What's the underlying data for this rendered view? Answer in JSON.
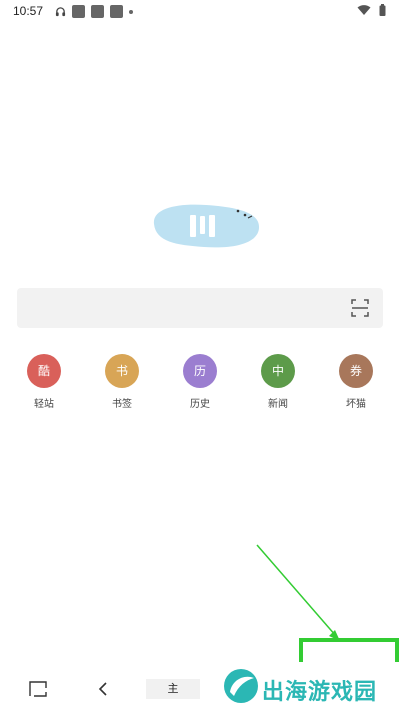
{
  "status_bar": {
    "time": "10:57"
  },
  "search": {
    "placeholder": ""
  },
  "shortcuts": [
    {
      "glyph": "酷",
      "label": "轻站",
      "color": "#d9605a"
    },
    {
      "glyph": "书",
      "label": "书签",
      "color": "#d8a556"
    },
    {
      "glyph": "历",
      "label": "历史",
      "color": "#9b7ed0"
    },
    {
      "glyph": "中",
      "label": "新闻",
      "color": "#5d9b4a"
    },
    {
      "glyph": "券",
      "label": "坏猫",
      "color": "#a8775b"
    }
  ],
  "bottom_nav": {
    "home_tab_label": "主"
  },
  "watermark": {
    "text": "出海游戏园"
  },
  "colors": {
    "logo_blob": "#bde1f2",
    "annotation": "#33cc33",
    "watermark": "#2bb7b4"
  }
}
